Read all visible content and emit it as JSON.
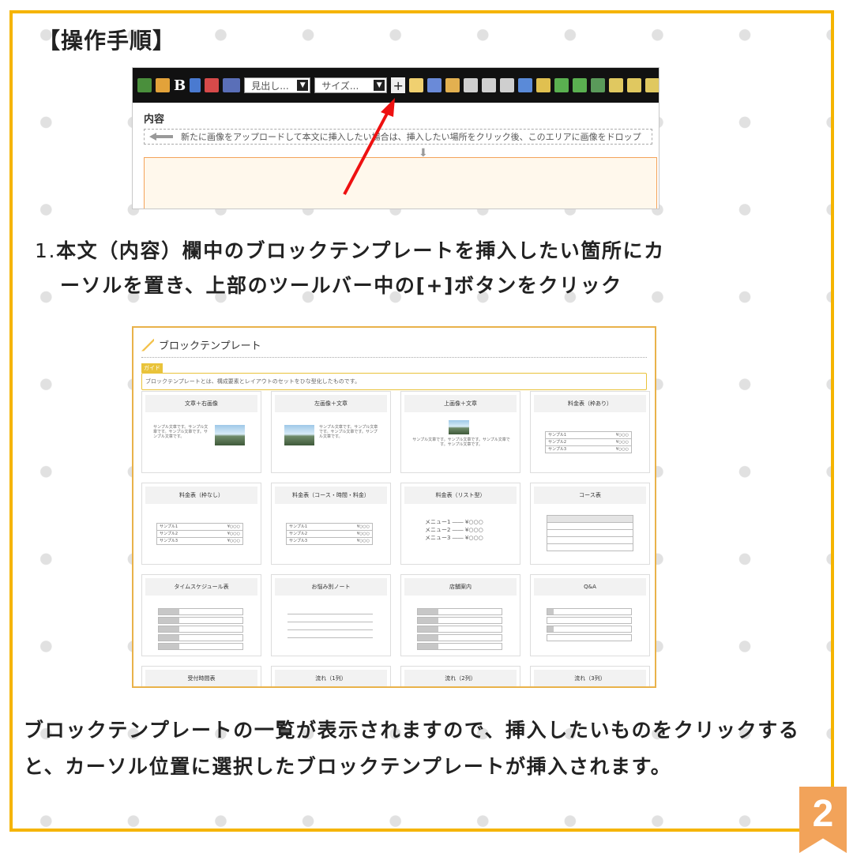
{
  "heading": "【操作手順】",
  "editor_shot": {
    "select1": "見出し...",
    "select2": "サイズ...",
    "content_label": "内容",
    "drop_hint": "新たに画像をアップロードして本文に挿入したい場合は、挿入したい場所をクリック後、このエリアに画像をドロップ"
  },
  "step1": {
    "number": "1.",
    "line1": "本文（内容）欄中のブロックテンプレートを挿入したい箇所にカ",
    "line2": "ーソルを置き、上部のツールバー中の[+]ボタンをクリック"
  },
  "template_shot": {
    "title": "ブロックテンプレート",
    "guide_tag": "ガイド",
    "guide_text": "ブロックテンプレートとは、構成要素とレイアウトのセットをひな型化したものです。",
    "cards": [
      "文章＋右画像",
      "左画像＋文章",
      "上画像＋文章",
      "料金表（枠あり）",
      "料金表（枠なし）",
      "料金表（コース・時間・料金）",
      "料金表（リスト型）",
      "コース表",
      "タイムスケジュール表",
      "お悩み別ノート",
      "店舗案内",
      "Q&A",
      "受付時間表",
      "流れ（1列）",
      "流れ（2列）",
      "流れ（3列）"
    ],
    "sample_text": "サンプル文章です。サンプル文章です。サンプル文章です。サンプル文章です。",
    "sample_rows": [
      "サンプル1",
      "サンプル2",
      "サンプル3"
    ],
    "price": "¥○○○",
    "menu_rows": [
      "メニュー1 ―― ¥○○○",
      "メニュー2 ―― ¥○○○",
      "メニュー3 ―― ¥○○○"
    ]
  },
  "bottom_text": "ブロックテンプレートの一覧が表示されますので、挿入したいものをクリックすると、カーソル位置に選択したブロックテンプレートが挿入されます。",
  "page_number": "2"
}
